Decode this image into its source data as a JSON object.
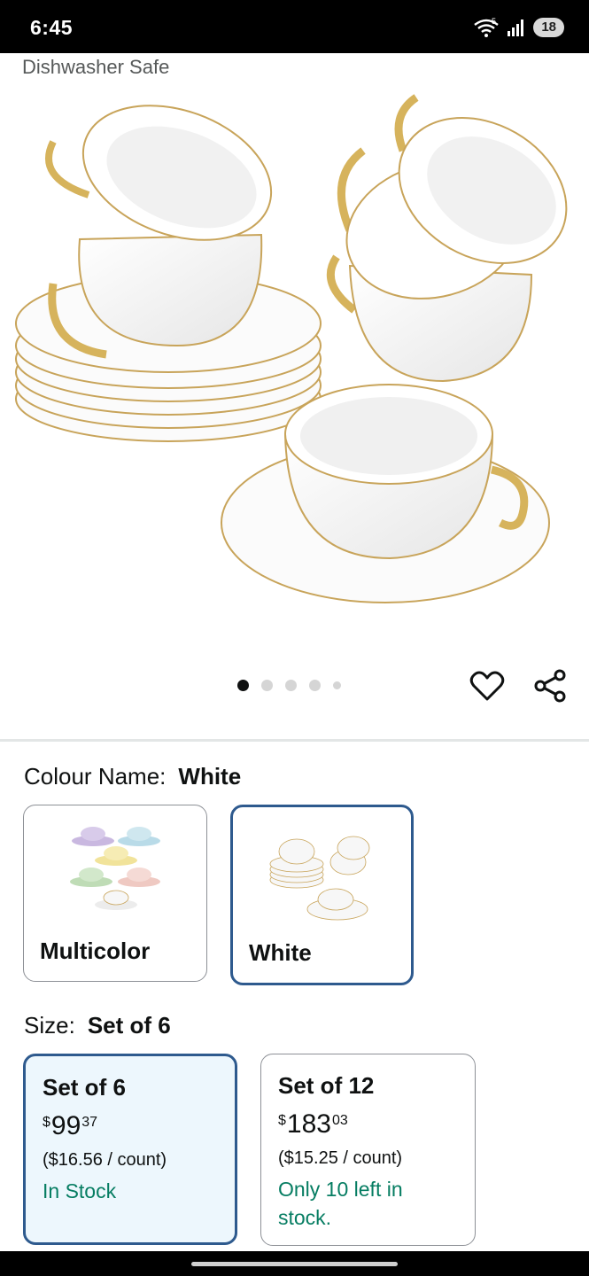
{
  "status_bar": {
    "time": "6:45",
    "battery": "18",
    "icons": [
      "wifi-icon",
      "signal-icon",
      "battery-icon"
    ]
  },
  "gallery": {
    "caption": "Dishwasher Safe",
    "image_label": "white porcelain teacups with gold rim and saucers",
    "dots_count": 5,
    "active_dot": 1
  },
  "colour": {
    "label": "Colour Name:",
    "selected": "White",
    "options": [
      {
        "name": "Multicolor"
      },
      {
        "name": "White"
      }
    ]
  },
  "size": {
    "label": "Size:",
    "selected": "Set of 6",
    "options": [
      {
        "title": "Set of 6",
        "currency": "$",
        "price_whole": "99",
        "price_fraction": "37",
        "unit_price": "($16.56 / count)",
        "stock": "In Stock"
      },
      {
        "title": "Set of 12",
        "currency": "$",
        "price_whole": "183",
        "price_fraction": "03",
        "unit_price": "($15.25 / count)",
        "stock_line1": "Only 10 left in",
        "stock_line2": "stock."
      }
    ]
  },
  "colors": {
    "selected_border": "#2e5a8e",
    "selected_bg": "#edf7fd",
    "stock_green": "#067d62"
  }
}
